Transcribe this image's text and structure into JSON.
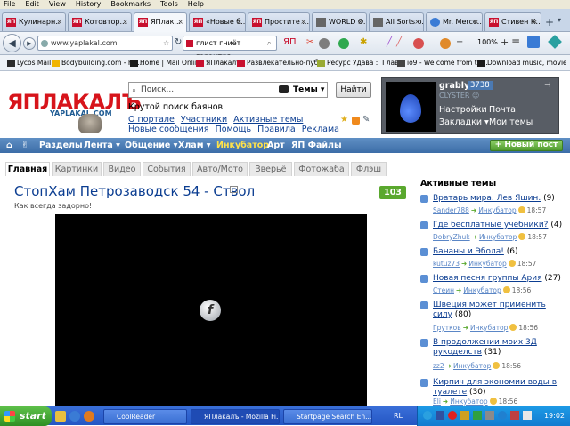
{
  "menubar": [
    "File",
    "Edit",
    "View",
    "History",
    "Bookmarks",
    "Tools",
    "Help"
  ],
  "tabs": [
    {
      "label": "Кулинарн...",
      "icon": "yap-icon"
    },
    {
      "label": "Котовтор...",
      "icon": "yap-icon"
    },
    {
      "label": "ЯПлак...",
      "icon": "yap-icon",
      "active": true
    },
    {
      "label": "«Новые б...",
      "icon": "yap-icon"
    },
    {
      "label": "Простите ...",
      "icon": "yap-icon"
    },
    {
      "label": "WORLD O...",
      "icon": "yap-icon"
    },
    {
      "label": "All Sorts o...",
      "icon": "yap-icon"
    },
    {
      "label": "Mr. Merce...",
      "icon": "yap-icon"
    },
    {
      "label": "Стивен К...",
      "icon": "yap-icon"
    }
  ],
  "url": "www.yaplakal.com",
  "browser_search": "глист гниёт гарантия",
  "zoom": "100%",
  "bookmarks": [
    {
      "label": "Lycos Mail",
      "color": "#2b2b2b"
    },
    {
      "label": "Bodybuilding.com - Hu...",
      "color": "#f0b400"
    },
    {
      "label": "Home | Mail Online",
      "color": "#1a1a1a"
    },
    {
      "label": "ЯПлакалъ",
      "color": "#c8102e"
    },
    {
      "label": "Развлекательно-пуб...",
      "color": "#c8102e"
    },
    {
      "label": "Ресурс Удава :: Глав...",
      "color": "#9a3"
    },
    {
      "label": "io9 - We come from th...",
      "color": "#444"
    },
    {
      "label": "Download music, movie...",
      "color": "#1a1a1a"
    }
  ],
  "site": {
    "logo": "ЯПЛАКАЛЪ",
    "logo_sub": "YAPLAKAL.COM",
    "search_placeholder": "Поиск...",
    "search_scope": "Темы",
    "find_button": "Найти",
    "tagline": "Крутой поиск баянов",
    "links_row1": [
      "О портале",
      "Участники",
      "Активные темы"
    ],
    "links_row2": [
      "Новые сообщения",
      "Помощь",
      "Правила",
      "Реклама"
    ]
  },
  "user": {
    "name": "grably",
    "count": "3738",
    "rank": "CLYSTER ☺",
    "settings": "Настройки",
    "mail": "Почта",
    "bookmarks": "Закладки ▾",
    "my_topics": "Мои темы"
  },
  "mainnav": [
    "Разделы",
    "Лента ▾",
    "Общение ▾",
    "Хлам ▾",
    "Инкубатор",
    "Арт",
    "ЯП Файлы"
  ],
  "new_post": "Новый пост",
  "subtabs": [
    "Главная",
    "Картинки",
    "Видео",
    "События",
    "Авто/Мото",
    "Зверьё",
    "Фотожаба",
    "Флэш"
  ],
  "post": {
    "title": "СтопХам Петрозаводск 54 - Ствол",
    "subtitle": "Как всегда задорно!",
    "count": "103"
  },
  "sidebar": {
    "heading": "Активные темы",
    "items": [
      {
        "title": "Вратарь мира. Лев Яшин.",
        "count": "(9)",
        "user": "Sander788",
        "section": "Инкубатор",
        "time": "18:57"
      },
      {
        "title": "Где бесплатные учебники?",
        "count": "(4)",
        "user": "DobryZhuk",
        "section": "Инкубатор",
        "time": "18:57"
      },
      {
        "title": "Бананы и Эбола!",
        "count": "(6)",
        "user": "kutuz73",
        "section": "Инкубатор",
        "time": "18:57"
      },
      {
        "title": "Новая песня группы Ария",
        "count": "(27)",
        "user": "Стеин",
        "section": "Инкубатор",
        "time": "18:56"
      },
      {
        "title": "Швеция может применить силу",
        "count": "(80)",
        "user": "Грутков",
        "section": "Инкубатор",
        "time": "18:56"
      },
      {
        "title": "В продолжении моих 3Д рукоделств",
        "count": "(31)",
        "user": "zz2",
        "section": "Инкубатор",
        "time": "18:56"
      },
      {
        "title": "Кирпич для экономии воды в туалете",
        "count": "(30)",
        "user": "Eli",
        "section": "Инкубатор",
        "time": "18:56"
      }
    ]
  },
  "taskbar": {
    "start": "start",
    "tasks": [
      "CoolReader",
      "ЯПлакалъ - Mozilla Fi...",
      "Startpage Search En..."
    ],
    "lang": "RL",
    "clock": "19:02"
  }
}
